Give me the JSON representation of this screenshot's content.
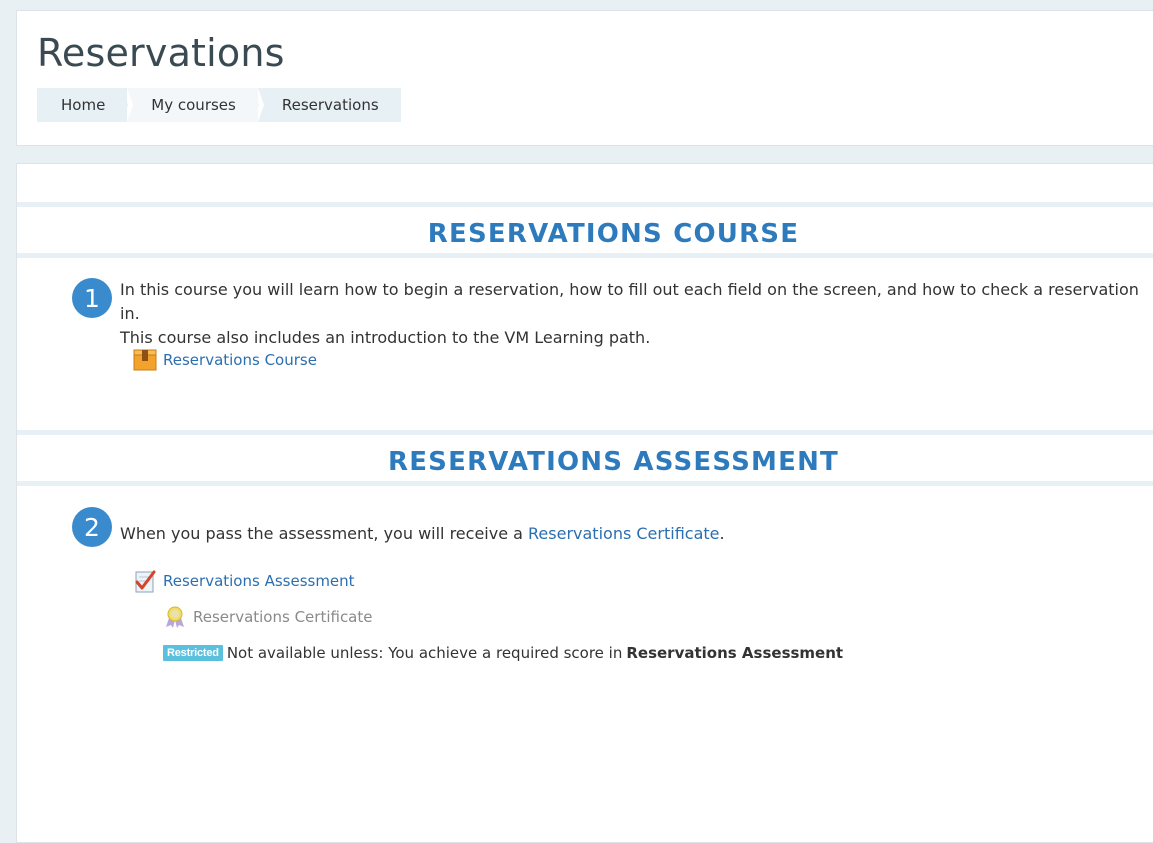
{
  "page": {
    "title": "Reservations",
    "breadcrumb": [
      "Home",
      "My courses",
      "Reservations"
    ]
  },
  "sections": [
    {
      "number": "1",
      "title": "RESERVATIONS COURSE",
      "summary_line1": "In this course you will learn how to begin a reservation, how to fill out each field on the screen, and how to check a reservation in.",
      "summary_line2": "This course also includes an introduction to the VM Learning path.",
      "activity": {
        "label": "Reservations Course",
        "icon": "package-icon"
      }
    },
    {
      "number": "2",
      "title": "RESERVATIONS ASSESSMENT",
      "summary_prefix": "When you pass the assessment, you will receive a ",
      "summary_link": "Reservations Certificate",
      "summary_suffix": ".",
      "activity": {
        "label": "Reservations Assessment",
        "icon": "quiz-checkmark-icon"
      },
      "sub_activity": {
        "label": "Reservations Certificate",
        "icon": "certificate-ribbon-icon"
      },
      "restriction": {
        "badge": "Restricted",
        "text": "Not available unless: You achieve a required score in",
        "target": "Reservations Assessment"
      }
    }
  ],
  "colors": {
    "accent": "#2d7bbd",
    "link": "#2b6fb0",
    "circle": "#3a8bcd",
    "badge": "#5bc0de",
    "background": "#e9f0f4"
  }
}
